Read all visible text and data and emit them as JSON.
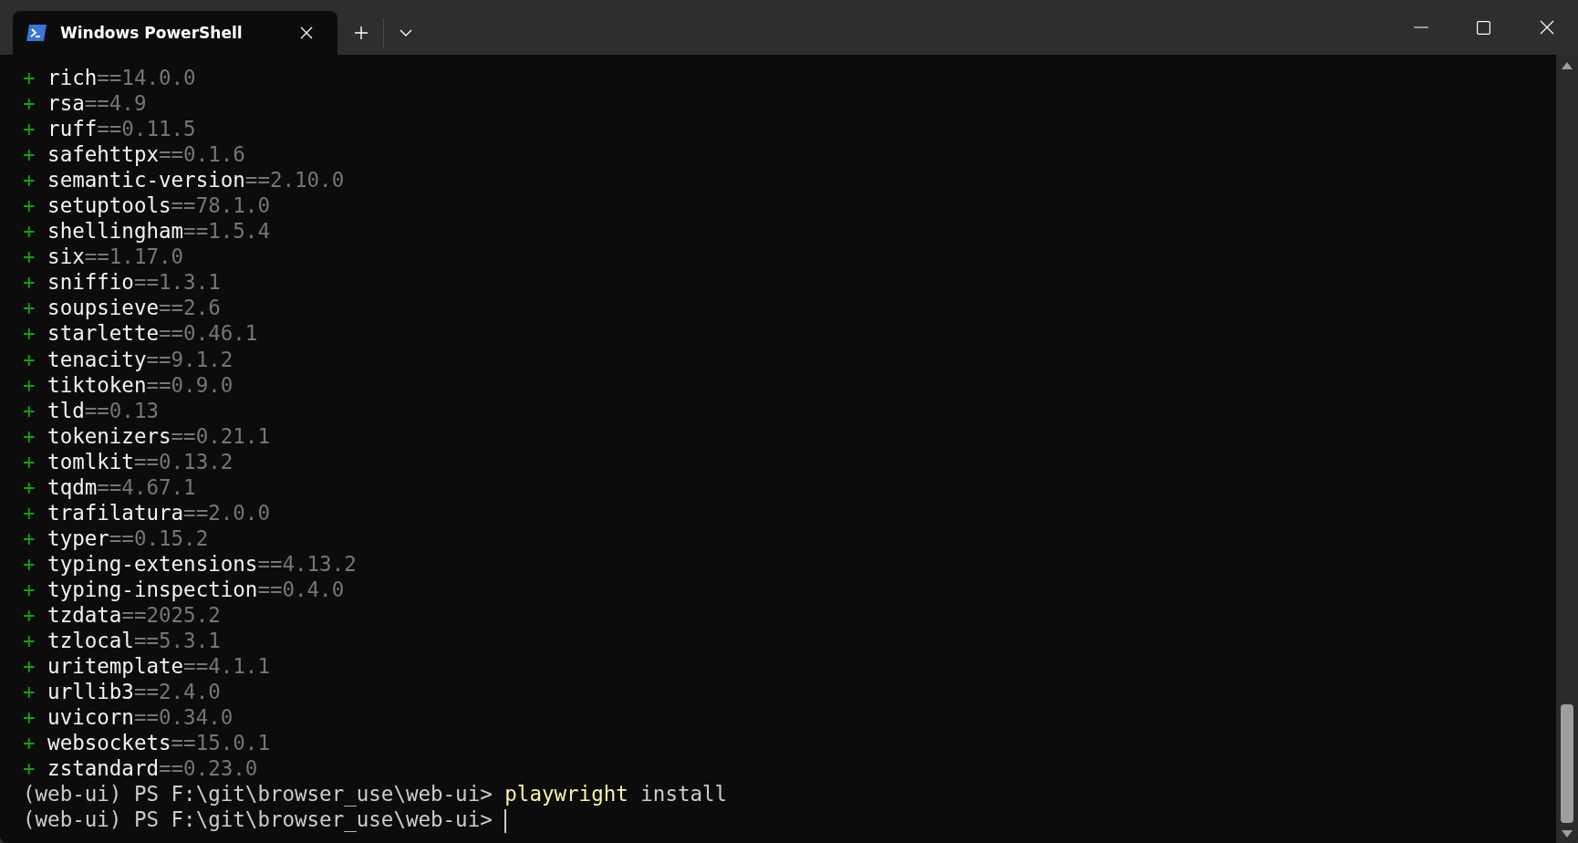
{
  "window": {
    "tab": {
      "title": "Windows PowerShell",
      "selected": true
    }
  },
  "terminal": {
    "packages": [
      {
        "marker": "+",
        "name": "rich",
        "version": "==14.0.0"
      },
      {
        "marker": "+",
        "name": "rsa",
        "version": "==4.9"
      },
      {
        "marker": "+",
        "name": "ruff",
        "version": "==0.11.5"
      },
      {
        "marker": "+",
        "name": "safehttpx",
        "version": "==0.1.6"
      },
      {
        "marker": "+",
        "name": "semantic-version",
        "version": "==2.10.0"
      },
      {
        "marker": "+",
        "name": "setuptools",
        "version": "==78.1.0"
      },
      {
        "marker": "+",
        "name": "shellingham",
        "version": "==1.5.4"
      },
      {
        "marker": "+",
        "name": "six",
        "version": "==1.17.0"
      },
      {
        "marker": "+",
        "name": "sniffio",
        "version": "==1.3.1"
      },
      {
        "marker": "+",
        "name": "soupsieve",
        "version": "==2.6"
      },
      {
        "marker": "+",
        "name": "starlette",
        "version": "==0.46.1"
      },
      {
        "marker": "+",
        "name": "tenacity",
        "version": "==9.1.2"
      },
      {
        "marker": "+",
        "name": "tiktoken",
        "version": "==0.9.0"
      },
      {
        "marker": "+",
        "name": "tld",
        "version": "==0.13"
      },
      {
        "marker": "+",
        "name": "tokenizers",
        "version": "==0.21.1"
      },
      {
        "marker": "+",
        "name": "tomlkit",
        "version": "==0.13.2"
      },
      {
        "marker": "+",
        "name": "tqdm",
        "version": "==4.67.1"
      },
      {
        "marker": "+",
        "name": "trafilatura",
        "version": "==2.0.0"
      },
      {
        "marker": "+",
        "name": "typer",
        "version": "==0.15.2"
      },
      {
        "marker": "+",
        "name": "typing-extensions",
        "version": "==4.13.2"
      },
      {
        "marker": "+",
        "name": "typing-inspection",
        "version": "==0.4.0"
      },
      {
        "marker": "+",
        "name": "tzdata",
        "version": "==2025.2"
      },
      {
        "marker": "+",
        "name": "tzlocal",
        "version": "==5.3.1"
      },
      {
        "marker": "+",
        "name": "uritemplate",
        "version": "==4.1.1"
      },
      {
        "marker": "+",
        "name": "urllib3",
        "version": "==2.4.0"
      },
      {
        "marker": "+",
        "name": "uvicorn",
        "version": "==0.34.0"
      },
      {
        "marker": "+",
        "name": "websockets",
        "version": "==15.0.1"
      },
      {
        "marker": "+",
        "name": "zstandard",
        "version": "==0.23.0"
      }
    ],
    "prompts": [
      {
        "prompt": "(web-ui) PS F:\\git\\browser_use\\web-ui>",
        "program": "playwright",
        "args": "install",
        "cursor": false
      },
      {
        "prompt": "(web-ui) PS F:\\git\\browser_use\\web-ui>",
        "cursor": true
      }
    ]
  }
}
